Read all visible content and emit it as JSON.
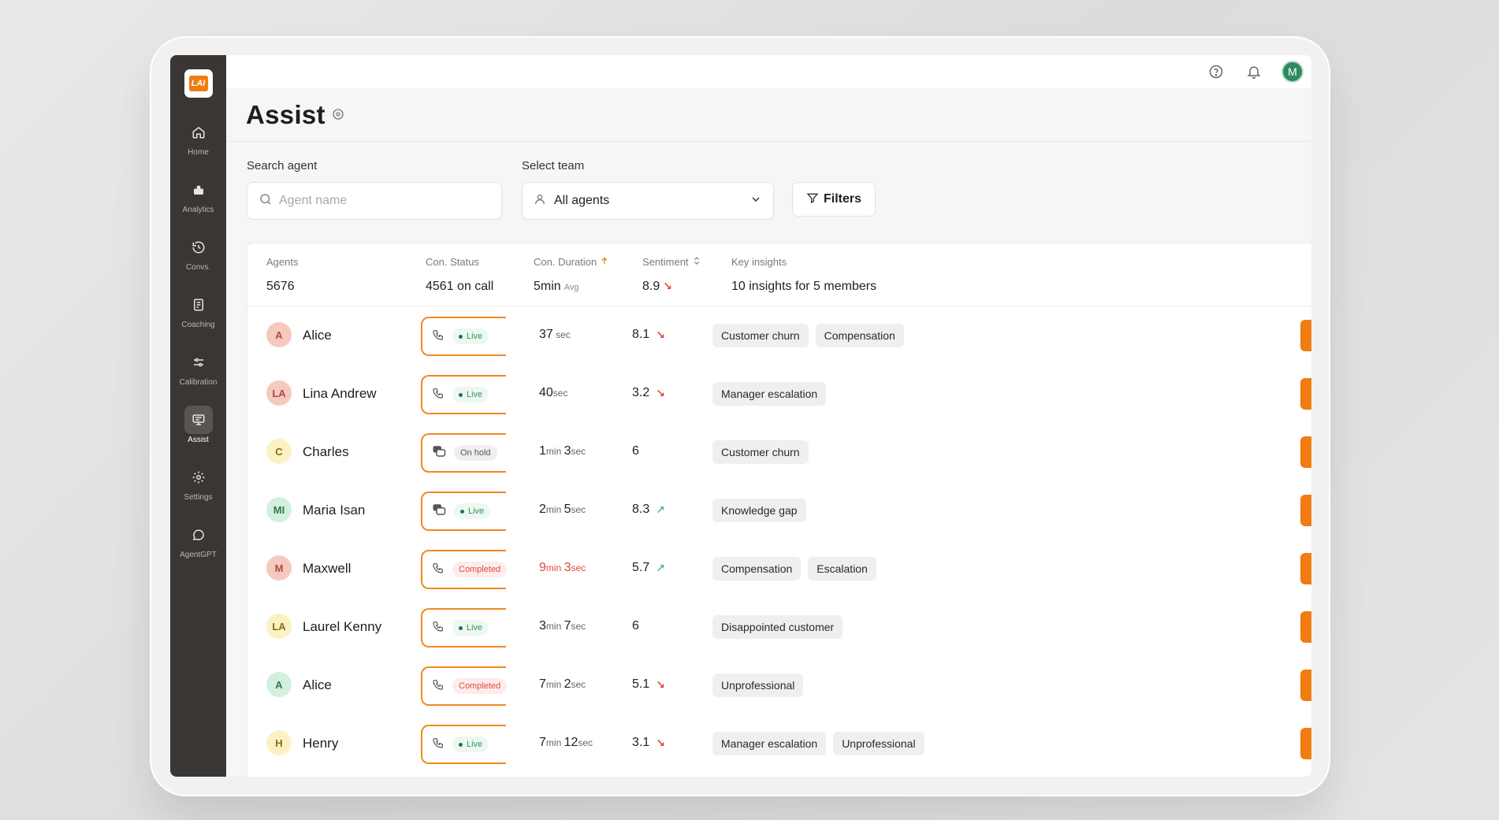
{
  "app": {
    "logo_text": "LAI"
  },
  "sidebar": {
    "items": [
      {
        "label": "Home",
        "icon": "home-icon"
      },
      {
        "label": "Analytics",
        "icon": "analytics-icon"
      },
      {
        "label": "Convs.",
        "icon": "history-icon"
      },
      {
        "label": "Coaching",
        "icon": "document-icon"
      },
      {
        "label": "Calibration",
        "icon": "sliders-icon"
      },
      {
        "label": "Assist",
        "icon": "monitor-icon",
        "active": true
      },
      {
        "label": "Settings",
        "icon": "gear-icon"
      },
      {
        "label": "AgentGPT",
        "icon": "chat-bubble-icon"
      }
    ]
  },
  "header": {
    "user_initial": "M"
  },
  "page": {
    "title": "Assist"
  },
  "search": {
    "label": "Search agent",
    "placeholder": "Agent name",
    "value": ""
  },
  "team": {
    "label": "Select team",
    "value": "All agents"
  },
  "filters": {
    "label": "Filters"
  },
  "summary": {
    "agents": {
      "header": "Agents",
      "value": "5676"
    },
    "status": {
      "header": "Con. Status",
      "value": "4561 on call"
    },
    "duration": {
      "header": "Con. Duration",
      "value": "5min",
      "suffix": "Avg"
    },
    "sentiment": {
      "header": "Sentiment",
      "value": "8.9",
      "trend": "down"
    },
    "insights": {
      "header": "Key insights",
      "value": "10 insights for 5 members"
    }
  },
  "rows": [
    {
      "initials": "A",
      "name": "Alice",
      "avatar_bg": "#f6c9c0",
      "avatar_fg": "#b2493a",
      "status_icon": "phone-icon",
      "status": "Live",
      "status_type": "live",
      "duration": [
        [
          "37",
          " sec"
        ]
      ],
      "duration_red": false,
      "sentiment": "8.1",
      "trend": "down",
      "insights": [
        "Customer churn",
        "Compensation"
      ]
    },
    {
      "initials": "LA",
      "name": "Lina Andrew",
      "avatar_bg": "#f6c9c0",
      "avatar_fg": "#b2493a",
      "status_icon": "phone-icon",
      "status": "Live",
      "status_type": "live",
      "duration": [
        [
          "40",
          "sec"
        ]
      ],
      "duration_red": false,
      "sentiment": "3.2",
      "trend": "down",
      "insights": [
        "Manager escalation"
      ]
    },
    {
      "initials": "C",
      "name": "Charles",
      "avatar_bg": "#fbf1c2",
      "avatar_fg": "#8a6d12",
      "status_icon": "chat-icon",
      "status": "On hold",
      "status_type": "hold",
      "duration": [
        [
          "1",
          "min "
        ],
        [
          "3",
          "sec"
        ]
      ],
      "duration_red": false,
      "sentiment": "6",
      "trend": "",
      "insights": [
        "Customer churn"
      ]
    },
    {
      "initials": "MI",
      "name": "Maria Isan",
      "avatar_bg": "#d3f0de",
      "avatar_fg": "#2b7a4b",
      "status_icon": "chat-icon",
      "status": "Live",
      "status_type": "live",
      "duration": [
        [
          "2",
          "min "
        ],
        [
          "5",
          "sec"
        ]
      ],
      "duration_red": false,
      "sentiment": "8.3",
      "trend": "up",
      "insights": [
        "Knowledge gap"
      ]
    },
    {
      "initials": "M",
      "name": "Maxwell",
      "avatar_bg": "#f6c9c0",
      "avatar_fg": "#b2493a",
      "status_icon": "phone-icon",
      "status": "Completed",
      "status_type": "done",
      "duration": [
        [
          "9",
          "min "
        ],
        [
          "3",
          "sec"
        ]
      ],
      "duration_red": true,
      "sentiment": "5.7",
      "trend": "up",
      "insights": [
        "Compensation",
        "Escalation"
      ]
    },
    {
      "initials": "LA",
      "name": "Laurel Kenny",
      "avatar_bg": "#fbf1c2",
      "avatar_fg": "#8a6d12",
      "status_icon": "phone-icon",
      "status": "Live",
      "status_type": "live",
      "duration": [
        [
          "3",
          "min "
        ],
        [
          "7",
          "sec"
        ]
      ],
      "duration_red": false,
      "sentiment": "6",
      "trend": "",
      "insights": [
        "Disappointed customer"
      ]
    },
    {
      "initials": "A",
      "name": "Alice",
      "avatar_bg": "#d3f0de",
      "avatar_fg": "#2b7a4b",
      "status_icon": "phone-icon",
      "status": "Completed",
      "status_type": "done",
      "duration": [
        [
          "7",
          "min "
        ],
        [
          "2",
          "sec"
        ]
      ],
      "duration_red": false,
      "sentiment": "5.1",
      "trend": "down",
      "insights": [
        "Unprofessional"
      ]
    },
    {
      "initials": "H",
      "name": "Henry",
      "avatar_bg": "#fbf1c2",
      "avatar_fg": "#8a6d12",
      "status_icon": "phone-icon",
      "status": "Live",
      "status_type": "live",
      "duration": [
        [
          "7",
          "min "
        ],
        [
          "12",
          "sec"
        ]
      ],
      "duration_red": false,
      "sentiment": "3.1",
      "trend": "down",
      "insights": [
        "Manager escalation",
        "Unprofessional"
      ]
    }
  ],
  "colors": {
    "accent": "#f07c12",
    "sidebar": "#3a3633",
    "live": "#2e9a5c",
    "completed": "#e0483c"
  }
}
